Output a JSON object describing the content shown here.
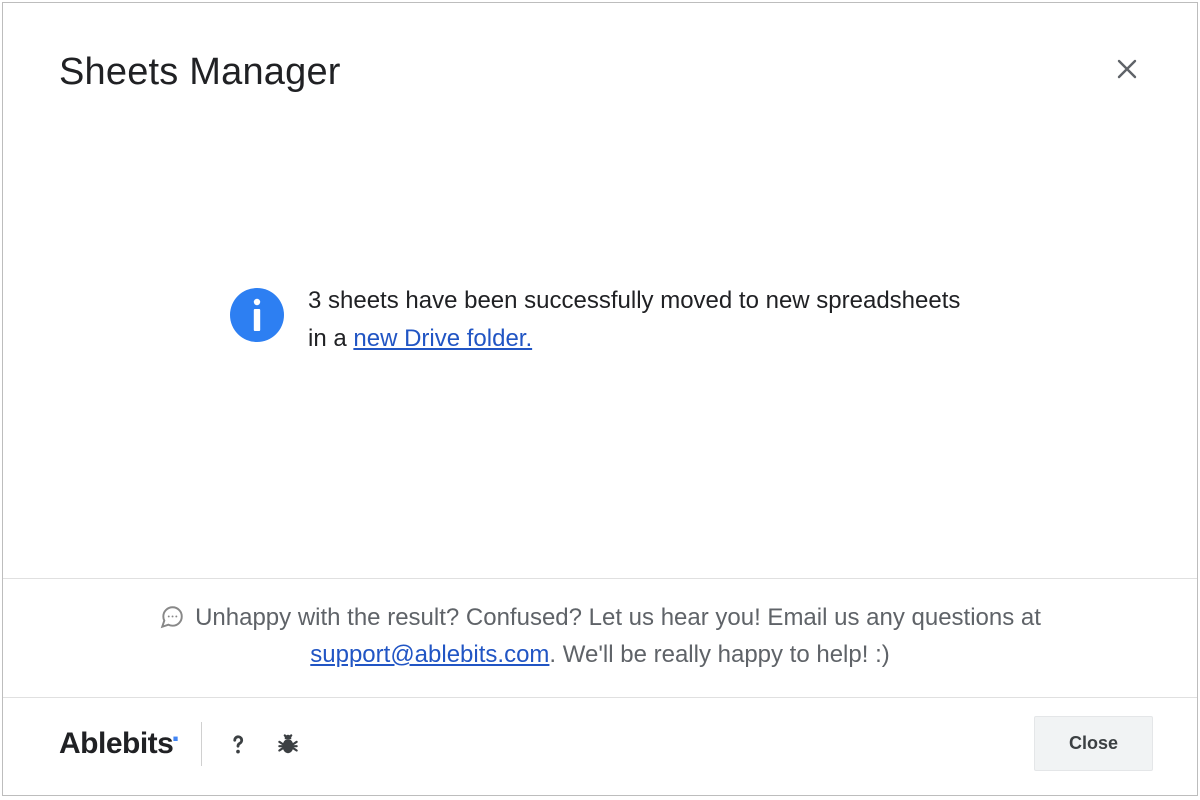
{
  "header": {
    "title": "Sheets Manager"
  },
  "message": {
    "text_before_link": "3 sheets have been successfully moved to new spreadsheets in a ",
    "link_text": "new Drive folder."
  },
  "feedback": {
    "text_before_email": "Unhappy with the result? Confused? Let us hear you! Email us any questions at ",
    "email": "support@ablebits.com",
    "text_after_email": ". We'll be really happy to help! :)"
  },
  "footer": {
    "brand": "Ablebits",
    "close_label": "Close"
  }
}
